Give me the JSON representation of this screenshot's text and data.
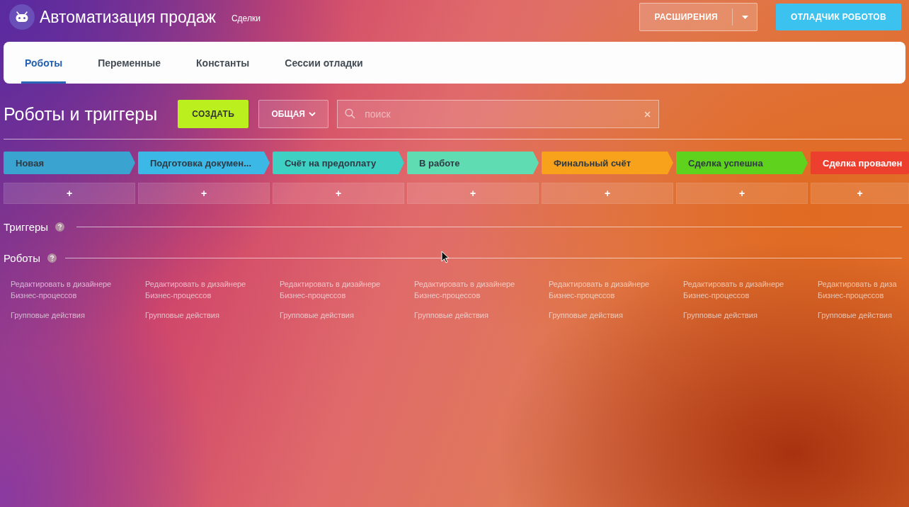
{
  "header": {
    "title": "Автоматизация продаж",
    "subtitle": "Сделки",
    "extensions_button": "РАСШИРЕНИЯ",
    "debugger_button": "ОТЛАДЧИК РОБОТОВ"
  },
  "tabs": [
    {
      "label": "Роботы",
      "selected": true
    },
    {
      "label": "Переменные",
      "selected": false
    },
    {
      "label": "Константы",
      "selected": false
    },
    {
      "label": "Сессии отладки",
      "selected": false
    }
  ],
  "toolbar": {
    "title": "Роботы и триггеры",
    "create_button": "СОЗДАТЬ",
    "filter_button": "ОБЩАЯ",
    "search": {
      "placeholder": "поиск"
    }
  },
  "stages": [
    {
      "name": "Новая",
      "color": "#3ba3cf",
      "add": "+",
      "edit_link": "Редактировать в дизайнере\nБизнес-процессов",
      "group_link": "Групповые действия"
    },
    {
      "name": "Подготовка докумен...",
      "color": "#3bb8e6",
      "add": "+",
      "edit_link": "Редактировать в дизайнере\nБизнес-процессов",
      "group_link": "Групповые действия"
    },
    {
      "name": "Счёт на предоплату",
      "color": "#3fd0c4",
      "add": "+",
      "edit_link": "Редактировать в дизайнере\nБизнес-процессов",
      "group_link": "Групповые действия"
    },
    {
      "name": "В работе",
      "color": "#5fdcb2",
      "add": "+",
      "edit_link": "Редактировать в дизайнере\nБизнес-процессов",
      "group_link": "Групповые действия"
    },
    {
      "name": "Финальный счёт",
      "color": "#f8a21c",
      "add": "+",
      "edit_link": "Редактировать в дизайнере\nБизнес-процессов",
      "group_link": "Групповые действия"
    },
    {
      "name": "Сделка успешна",
      "color": "#5fd21e",
      "add": "+",
      "edit_link": "Редактировать в дизайнере\nБизнес-процессов",
      "group_link": "Групповые действия"
    },
    {
      "name": "Сделка провален",
      "color": "#ec3f2e",
      "add": "+",
      "edit_link": "Редактировать в диза\nБизнес-процессов",
      "group_link": "Групповые действия"
    }
  ],
  "sections": [
    {
      "title": "Триггеры"
    },
    {
      "title": "Роботы"
    }
  ]
}
